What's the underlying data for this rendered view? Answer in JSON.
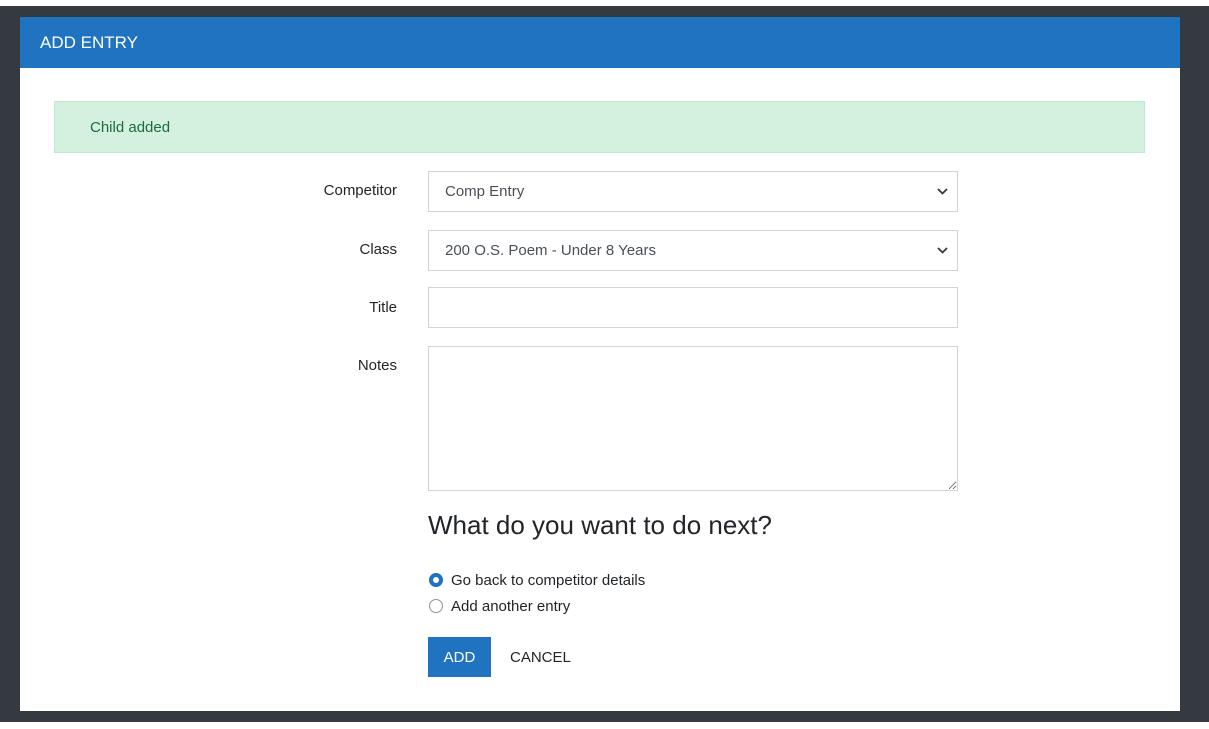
{
  "modal": {
    "title": "ADD ENTRY"
  },
  "alert": {
    "message": "Child added"
  },
  "form": {
    "competitor": {
      "label": "Competitor",
      "value": "Comp Entry"
    },
    "class": {
      "label": "Class",
      "value": "200 O.S. Poem - Under 8 Years"
    },
    "title": {
      "label": "Title",
      "value": ""
    },
    "notes": {
      "label": "Notes",
      "value": ""
    }
  },
  "next": {
    "heading": "What do you want to do next?",
    "options": [
      {
        "label": "Go back to competitor details",
        "checked": true
      },
      {
        "label": "Add another entry",
        "checked": false
      }
    ]
  },
  "actions": {
    "add_label": "ADD",
    "cancel_label": "CANCEL"
  },
  "colors": {
    "primary": "#1f73c0",
    "success_bg": "#d4f1e0",
    "success_text": "#1e6b3a",
    "backdrop": "#343a40"
  },
  "icons": {
    "select_arrow": "chevron-down-icon"
  }
}
